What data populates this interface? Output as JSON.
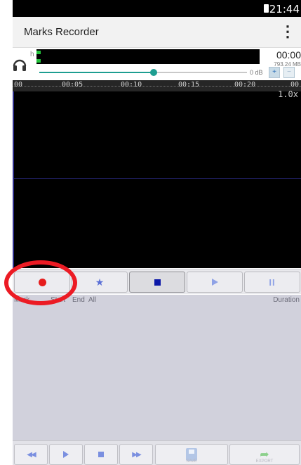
{
  "status_bar": {
    "time": "21:44"
  },
  "app_bar": {
    "title": "Marks Recorder",
    "menu_icon": "more-vert-icon"
  },
  "monitor": {
    "input_label": "h",
    "elapsed": "00:00",
    "file_size": "793.24 MB",
    "gain_label": "0 dB",
    "gain_level": 0.55
  },
  "timeline": {
    "ticks": [
      "00",
      "00:05",
      "00:10",
      "00:15",
      "00:20",
      "00"
    ],
    "zoom": "1.0x"
  },
  "controls": {
    "record_icon": "record-icon",
    "mark_icon": "star-icon",
    "stop_icon": "stop-icon",
    "play_icon": "play-icon",
    "pause_icon": "pause-icon"
  },
  "marks_table": {
    "columns": [
      "Mark",
      "Start",
      "End",
      "All",
      "Duration"
    ]
  },
  "bottom_toolbar": {
    "rewind_icon": "rewind-icon",
    "play_icon": "play-icon",
    "stop_icon": "stop-icon",
    "forward_icon": "fast-forward-icon",
    "save_label": "SAVE",
    "export_label": "EXPORT"
  },
  "colors": {
    "record": "#e61d1d",
    "accent": "#1e9e91",
    "highlight_ring": "#ec1b24",
    "marks_bg": "#d1d1dc"
  }
}
